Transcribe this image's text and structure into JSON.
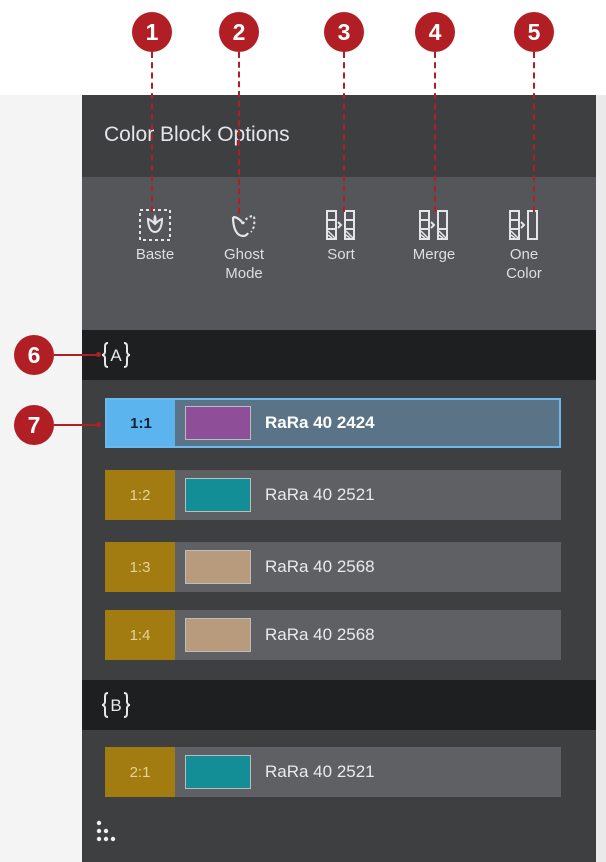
{
  "callouts": [
    "1",
    "2",
    "3",
    "4",
    "5",
    "6",
    "7"
  ],
  "panel": {
    "title": "Color Block Options"
  },
  "toolbar": {
    "baste": {
      "label": "Baste",
      "icon": "baste-icon"
    },
    "ghost": {
      "label_line1": "Ghost",
      "label_line2": "Mode",
      "icon": "ghost-mode-icon"
    },
    "sort": {
      "label": "Sort",
      "icon": "sort-icon"
    },
    "merge": {
      "label": "Merge",
      "icon": "merge-icon"
    },
    "one_color": {
      "label_line1": "One",
      "label_line2": "Color",
      "icon": "one-color-icon"
    }
  },
  "groups": [
    {
      "letter": "A",
      "rows": [
        {
          "num": "1:1",
          "thread": "RaRa 40 2424",
          "color": "#8e4e98",
          "selected": true
        },
        {
          "num": "1:2",
          "thread": "RaRa 40 2521",
          "color": "#138d96",
          "selected": false
        },
        {
          "num": "1:3",
          "thread": "RaRa 40 2568",
          "color": "#b89a7d",
          "selected": false
        },
        {
          "num": "1:4",
          "thread": "RaRa 40 2568",
          "color": "#b89a7d",
          "selected": false
        }
      ]
    },
    {
      "letter": "B",
      "rows": [
        {
          "num": "2:1",
          "thread": "RaRa 40 2521",
          "color": "#138d96",
          "selected": false
        }
      ]
    }
  ],
  "colors": {
    "callout": "#b11f24",
    "panel": "#3e3f41",
    "toolbar": "#545659",
    "group_header": "#1e1f21",
    "selected_number": "#5bb4ee",
    "number": "#a27c10"
  }
}
